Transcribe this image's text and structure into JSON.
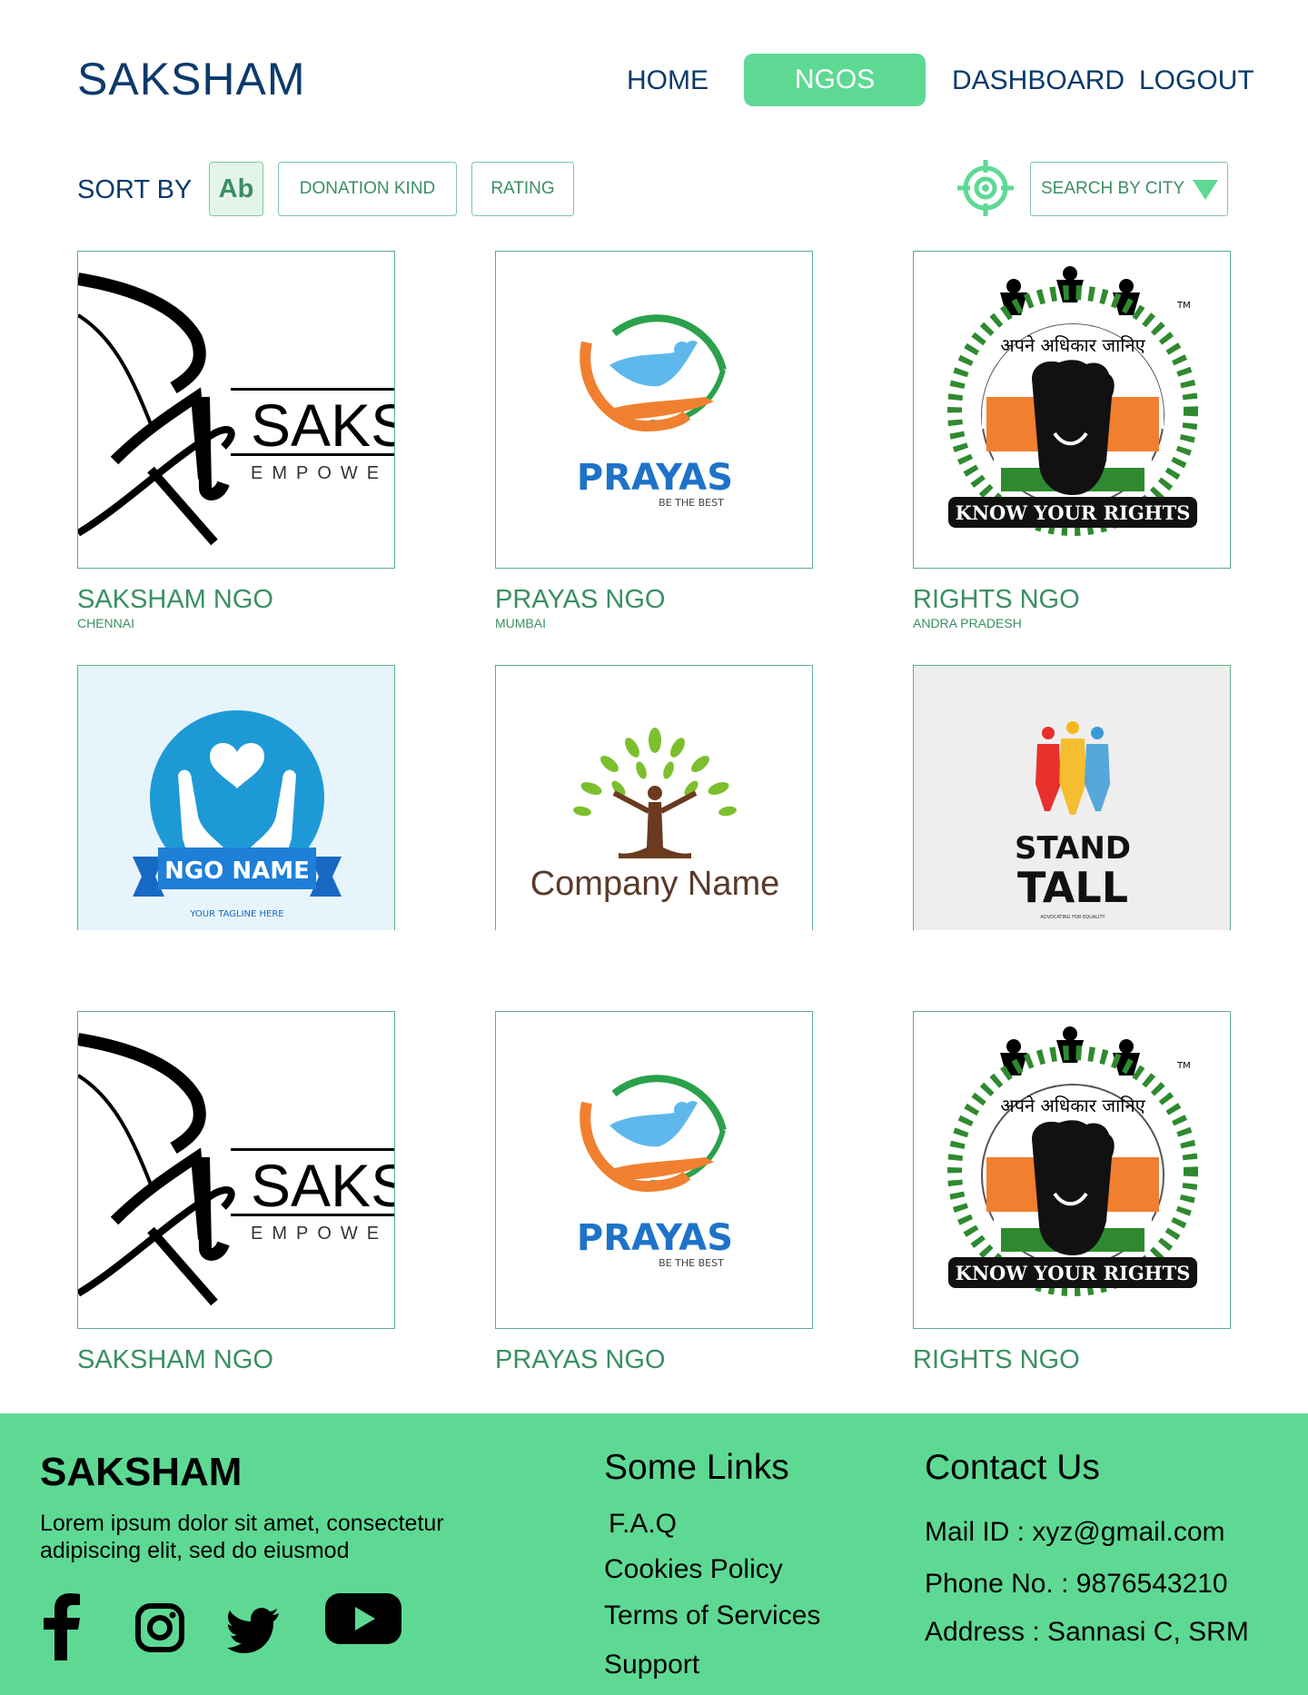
{
  "header": {
    "brand": "SAKSHAM",
    "nav": {
      "home": "HOME",
      "ngos": "NGOS",
      "dashboard": "DASHBOARD",
      "logout": "LOGOUT"
    },
    "active_color": "#5ed994"
  },
  "sort": {
    "label": "SORT BY",
    "alpha": "Ab",
    "donation": "DONATION KIND",
    "rating": "RATING",
    "city_placeholder": "SEARCH BY CITY"
  },
  "cards": [
    {
      "name": "SAKSHAM NGO",
      "city": "CHENNAI",
      "logo": "saksham-logo"
    },
    {
      "name": "PRAYAS NGO",
      "city": "MUMBAI",
      "logo": "prayas-logo"
    },
    {
      "name": "RIGHTS NGO",
      "city": "ANDRA PRADESH",
      "logo": "rights-logo"
    },
    {
      "name": "",
      "city": "",
      "logo": "ngo-name-logo",
      "logo_text": "NGO NAME",
      "logo_tagline": "YOUR TAGLINE HERE"
    },
    {
      "name": "",
      "city": "",
      "logo": "company-name-logo",
      "logo_text": "Company Name"
    },
    {
      "name": "",
      "city": "",
      "logo": "stand-tall-logo",
      "logo_text_1": "STAND",
      "logo_text_2": "TALL",
      "logo_tagline": "ADVOCATING FOR EQUALITY"
    },
    {
      "name": "SAKSHAM NGO",
      "city": "",
      "logo": "saksham-logo"
    },
    {
      "name": "PRAYAS NGO",
      "city": "",
      "logo": "prayas-logo"
    },
    {
      "name": "RIGHTS NGO",
      "city": "",
      "logo": "rights-logo"
    }
  ],
  "logos": {
    "saksham_text": "SAKS",
    "saksham_sub": "EMPOWE",
    "prayas_text": "PRAYAS",
    "prayas_sub": "BE THE BEST",
    "rights_hindi": "अपने अधिकार जानिए",
    "rights_text": "KNOW YOUR RIGHTS",
    "rights_tm": "TM"
  },
  "footer": {
    "brand": "SAKSHAM",
    "text": "Lorem ipsum dolor sit amet, consectetur adipiscing elit, sed do eiusmod",
    "links_title": "Some Links",
    "links": [
      "F.A.Q",
      "Cookies Policy",
      "Terms of Services",
      "Support"
    ],
    "contact_title": "Contact Us",
    "mail": "Mail ID : xyz@gmail.com",
    "phone": "Phone No. : 9876543210",
    "address": "Address : Sannasi C, SRM",
    "social": [
      "facebook-icon",
      "instagram-icon",
      "twitter-icon",
      "youtube-icon"
    ]
  }
}
